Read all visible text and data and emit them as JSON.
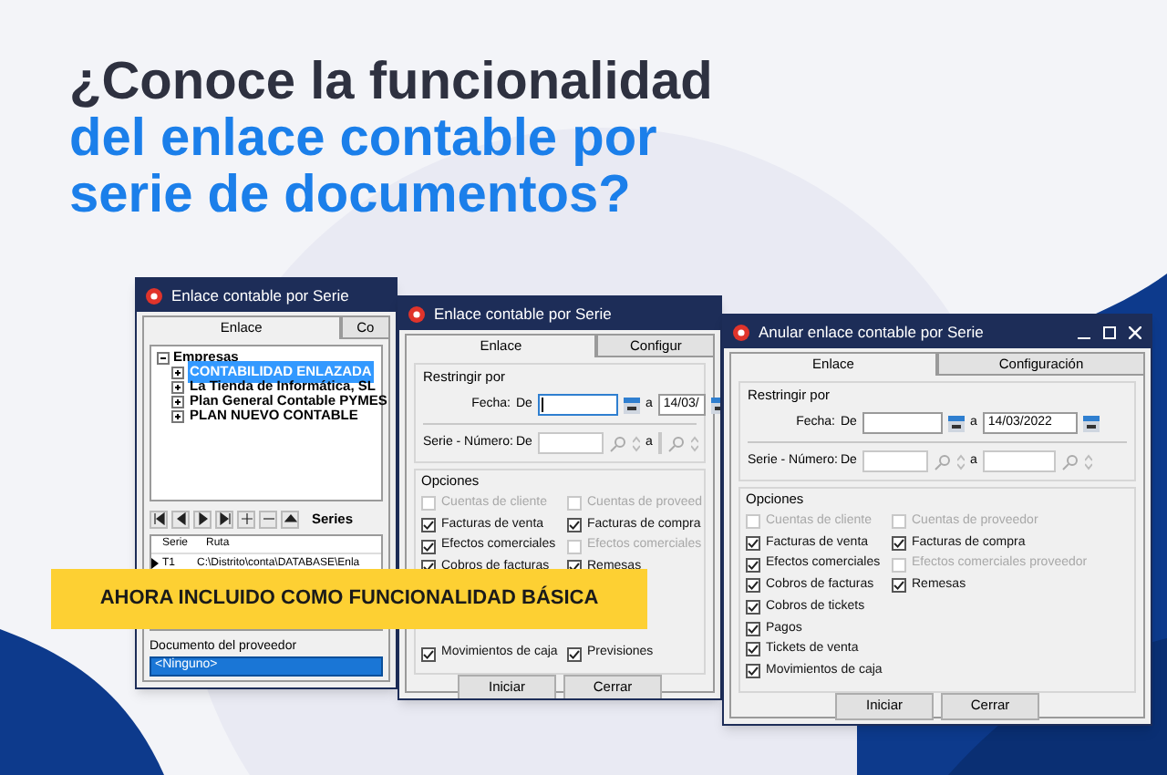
{
  "headline": {
    "line_1": "¿Conoce la funcionalidad",
    "line_2": "del enlace contable por",
    "line_3": "serie de documentos?"
  },
  "windows": [
    {
      "kind": "tree",
      "title": "Enlace contable por Serie",
      "controls": false,
      "partly_covered": true,
      "tabs": [
        {
          "label": "Enlace",
          "selected": true
        },
        {
          "label": "Co",
          "selected": false
        }
      ],
      "tree": {
        "label": "Empresas",
        "expanded": true,
        "children": [
          {
            "label": "CONTABILIDAD ENLAZADA",
            "selected": true,
            "expanded": false
          },
          {
            "label": "La Tienda de Informática, SL",
            "selected": false,
            "expanded": false
          },
          {
            "label": "Plan General Contable PYMES",
            "selected": false,
            "expanded": false
          },
          {
            "label": "PLAN NUEVO CONTABLE",
            "selected": false,
            "expanded": false
          }
        ]
      },
      "toolbar_label": "Series",
      "table": {
        "columns": [
          "Serie",
          "Ruta"
        ],
        "rows": [
          {
            "cells": [
              "T1",
              "C:\\Distrito\\conta\\DATABASE\\Enla"
            ],
            "current": true
          }
        ]
      },
      "document_label": "Documento del proveedor",
      "document_value": "<Ninguno>"
    },
    {
      "kind": "form",
      "title": "Enlace contable por Serie",
      "controls": false,
      "partly_covered": true,
      "tabs": [
        {
          "label": "Enlace",
          "selected": true
        },
        {
          "label": "Configur",
          "selected": false
        }
      ],
      "group_title": "Restringir por",
      "date_label": "Fecha:",
      "from_label": "De",
      "to_label": "a",
      "date_from_focused": true,
      "date_to": "14/03/",
      "serie_label": "Serie - Número:",
      "serie_from_label": "De",
      "serie_to_label": "a",
      "options_title": "Opciones",
      "options_left": [
        {
          "label": "Cuentas de cliente",
          "checked": false,
          "disabled": true
        },
        {
          "label": "Facturas de venta",
          "checked": true,
          "disabled": false
        },
        {
          "label": "Efectos comerciales",
          "checked": true,
          "disabled": false
        },
        {
          "label": "Cobros de facturas",
          "checked": true,
          "disabled": false
        },
        {
          "label": "Movimientos de caja",
          "checked": true,
          "disabled": false
        }
      ],
      "options_right": [
        {
          "label": "Cuentas de proveed",
          "checked": false,
          "disabled": true
        },
        {
          "label": "Facturas de compra",
          "checked": true,
          "disabled": false
        },
        {
          "label": "Efectos comerciales",
          "checked": false,
          "disabled": true
        },
        {
          "label": "Remesas",
          "checked": true,
          "disabled": false
        },
        {
          "label": "Previsiones",
          "checked": true,
          "disabled": false
        }
      ],
      "buttons": [
        "Iniciar",
        "Cerrar"
      ]
    },
    {
      "kind": "form",
      "title": "Anular enlace contable por Serie",
      "controls": true,
      "partly_covered": false,
      "tabs": [
        {
          "label": "Enlace",
          "selected": true
        },
        {
          "label": "Configuración",
          "selected": false
        }
      ],
      "group_title": "Restringir por",
      "date_label": "Fecha:",
      "from_label": "De",
      "to_label": "a",
      "date_from_focused": false,
      "date_to": "14/03/2022",
      "serie_label": "Serie - Número:",
      "serie_from_label": "De",
      "serie_to_label": "a",
      "options_title": "Opciones",
      "options_left": [
        {
          "label": "Cuentas de cliente",
          "checked": false,
          "disabled": true
        },
        {
          "label": "Facturas de venta",
          "checked": true,
          "disabled": false
        },
        {
          "label": "Efectos comerciales",
          "checked": true,
          "disabled": false
        },
        {
          "label": "Cobros de facturas",
          "checked": true,
          "disabled": false
        },
        {
          "label": "Cobros de tickets",
          "checked": true,
          "disabled": false
        },
        {
          "label": "Pagos",
          "checked": true,
          "disabled": false
        },
        {
          "label": "Tickets de venta",
          "checked": true,
          "disabled": false
        },
        {
          "label": "Movimientos de caja",
          "checked": true,
          "disabled": false
        }
      ],
      "options_right": [
        {
          "label": "Cuentas de proveedor",
          "checked": false,
          "disabled": true
        },
        {
          "label": "Facturas de compra",
          "checked": true,
          "disabled": false
        },
        {
          "label": "Efectos comerciales proveedor",
          "checked": false,
          "disabled": true
        },
        {
          "label": "Remesas",
          "checked": true,
          "disabled": false
        }
      ],
      "buttons": [
        "Iniciar",
        "Cerrar"
      ]
    }
  ],
  "banner": "AHORA INCLUIDO COMO FUNCIONALIDAD BÁSICA"
}
